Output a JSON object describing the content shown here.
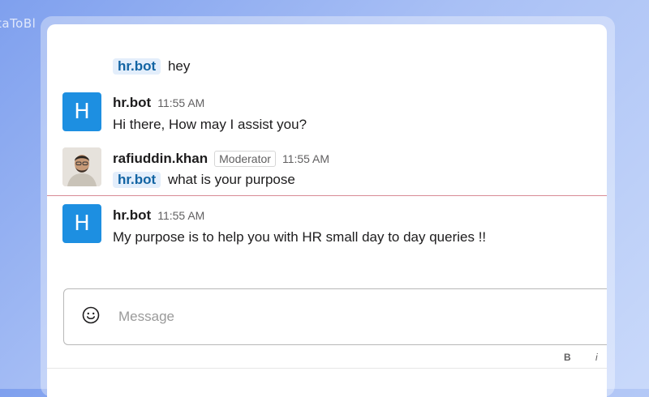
{
  "watermark": "taToBl",
  "messages": [
    {
      "mention": "hr.bot",
      "text": "hey"
    },
    {
      "avatar_letter": "H",
      "sender": "hr.bot",
      "time": "11:55 AM",
      "text": "Hi there, How may I assist you?"
    },
    {
      "sender": "rafiuddin.khan",
      "role": "Moderator",
      "time": "11:55 AM",
      "mention": "hr.bot",
      "text": "what is your purpose"
    },
    {
      "avatar_letter": "H",
      "sender": "hr.bot",
      "time": "11:55 AM",
      "text": "My purpose is to help you with HR small day to day queries !!"
    }
  ],
  "composer": {
    "placeholder": "Message",
    "emoji_icon": "smiley-icon",
    "format_bold": "B",
    "format_italic": "i"
  },
  "colors": {
    "accent": "#1d8fe1",
    "mention_bg": "#e3eefb",
    "mention_text": "#1264a3",
    "new_divider": "#d88a95"
  }
}
